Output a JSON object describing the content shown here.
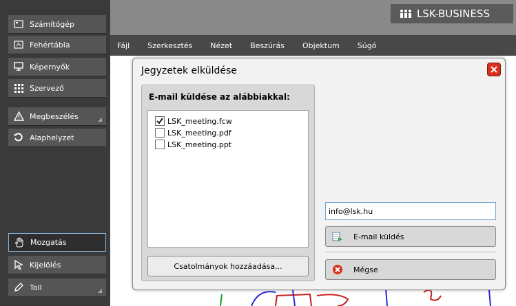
{
  "sidebar": {
    "items": [
      {
        "label": "Számítógép",
        "icon": "computer-icon"
      },
      {
        "label": "Fehértábla",
        "icon": "whiteboard-icon"
      },
      {
        "label": "Képernyők",
        "icon": "monitor-icon"
      },
      {
        "label": "Szervező",
        "icon": "grid-icon"
      },
      {
        "label": "Megbeszélés",
        "icon": "warning-icon"
      },
      {
        "label": "Alaphelyzet",
        "icon": "reset-icon"
      },
      {
        "label": "Mozgatás",
        "icon": "hand-icon"
      },
      {
        "label": "Kijelölés",
        "icon": "pointer-icon"
      },
      {
        "label": "Toll",
        "icon": "pen-icon"
      }
    ]
  },
  "brand": {
    "label": "LSK-BUSINESS",
    "icon": "people-icon"
  },
  "menu": {
    "items": [
      "Fájl",
      "Szerkesztés",
      "Nézet",
      "Beszúrás",
      "Objektum",
      "Súgó"
    ]
  },
  "dialog": {
    "title": "Jegyzetek elküldése",
    "panel_title": "E-mail küldése az alábbiakkal:",
    "files": [
      {
        "name": "LSK_meeting.fcw",
        "checked": true
      },
      {
        "name": "LSK_meeting.pdf",
        "checked": false
      },
      {
        "name": "LSK_meeting.ppt",
        "checked": false
      }
    ],
    "attach_label": "Csatolmányok hozzáadása...",
    "email_value": "info@lsk.hu",
    "send_label": "E-mail küldés",
    "cancel_label": "Mégse"
  },
  "colors": {
    "close": "#d9301e",
    "cancel_icon": "#d9301e",
    "input_border": "#7aa6d6"
  }
}
